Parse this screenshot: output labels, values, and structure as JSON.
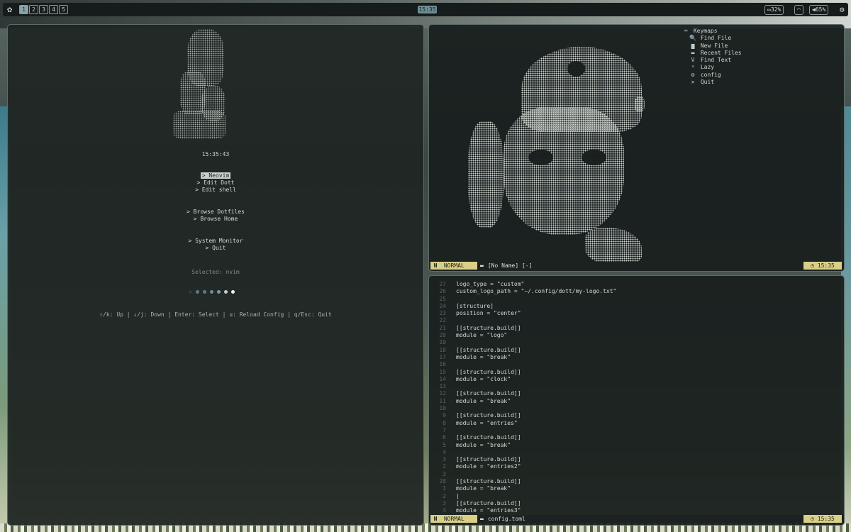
{
  "topbar": {
    "logo_icon": "gear-flower-icon",
    "workspaces": [
      "1",
      "2",
      "3",
      "4",
      "5"
    ],
    "active_workspace": "1",
    "clock": "15:35",
    "battery": "32%",
    "volume": "65%",
    "settings_icon": "gear-icon"
  },
  "dashboard": {
    "time": "15:35:43",
    "menu_group1": [
      "> Neovim",
      "> Edit Dott",
      "> Edit shell"
    ],
    "menu_group2": [
      "> Browse Dotfiles",
      "> Browse Home"
    ],
    "menu_group3": [
      "> System Monitor",
      "> Quit"
    ],
    "selected": "Selected: nvim",
    "dot_colors": [
      "#2c3a3a",
      "#5c7d86",
      "#5c7d86",
      "#6f8f96",
      "#7d9da3",
      "#c7cfc9",
      "#f0f2ee"
    ],
    "help": "↑/k: Up | ↓/j: Down | Enter: Select | u: Reload Config | q/Esc: Quit"
  },
  "top_right": {
    "keymaps_title": "Keymaps",
    "keymaps": [
      {
        "icon": "🔍",
        "label": "Find File"
      },
      {
        "icon": "▆",
        "label": "New File"
      },
      {
        "icon": "▬",
        "label": "Recent Files"
      },
      {
        "icon": "V",
        "label": "Find Text"
      },
      {
        "icon": "ᵃ",
        "label": "Lazy"
      },
      {
        "icon": "⚙",
        "label": "config"
      },
      {
        "icon": "✕",
        "label": "Quit"
      }
    ],
    "status": {
      "mode_icon": "N",
      "mode": "NORMAL",
      "file": "[No Name] [-]",
      "clock": "15:35"
    }
  },
  "editor": {
    "lines": [
      {
        "n": "27",
        "t": "logo_type = \"custom\""
      },
      {
        "n": "26",
        "t": "custom_logo_path = \"~/.config/dott/my-logo.txt\""
      },
      {
        "n": "25",
        "t": ""
      },
      {
        "n": "24",
        "t": "[structure]"
      },
      {
        "n": "23",
        "t": "position = \"center\""
      },
      {
        "n": "22",
        "t": ""
      },
      {
        "n": "21",
        "t": "[[structure.build]]"
      },
      {
        "n": "20",
        "t": "module = \"logo\""
      },
      {
        "n": "19",
        "t": ""
      },
      {
        "n": "18",
        "t": "[[structure.build]]"
      },
      {
        "n": "17",
        "t": "module = \"break\""
      },
      {
        "n": "16",
        "t": ""
      },
      {
        "n": "15",
        "t": "[[structure.build]]"
      },
      {
        "n": "14",
        "t": "module = \"clock\""
      },
      {
        "n": "13",
        "t": ""
      },
      {
        "n": "12",
        "t": "[[structure.build]]"
      },
      {
        "n": "11",
        "t": "module = \"break\""
      },
      {
        "n": "10",
        "t": ""
      },
      {
        "n": "9",
        "t": "[[structure.build]]"
      },
      {
        "n": "8",
        "t": "module = \"entries\""
      },
      {
        "n": "7",
        "t": ""
      },
      {
        "n": "6",
        "t": "[[structure.build]]"
      },
      {
        "n": "5",
        "t": "module = \"break\""
      },
      {
        "n": "4",
        "t": ""
      },
      {
        "n": "3",
        "t": "[[structure.build]]"
      },
      {
        "n": "2",
        "t": "module = \"entries2\""
      },
      {
        "n": "3",
        "t": ""
      },
      {
        "n": "28",
        "t": "[[structure.build]]"
      },
      {
        "n": "1",
        "t": "module = \"break\""
      },
      {
        "n": "2",
        "t": "|"
      },
      {
        "n": "3",
        "t": "[[structure.build]]"
      },
      {
        "n": "4",
        "t": "module = \"entries3\""
      }
    ],
    "status": {
      "mode_icon": "N",
      "mode": "NORMAL",
      "file": "config.toml",
      "clock": "15:35"
    }
  }
}
